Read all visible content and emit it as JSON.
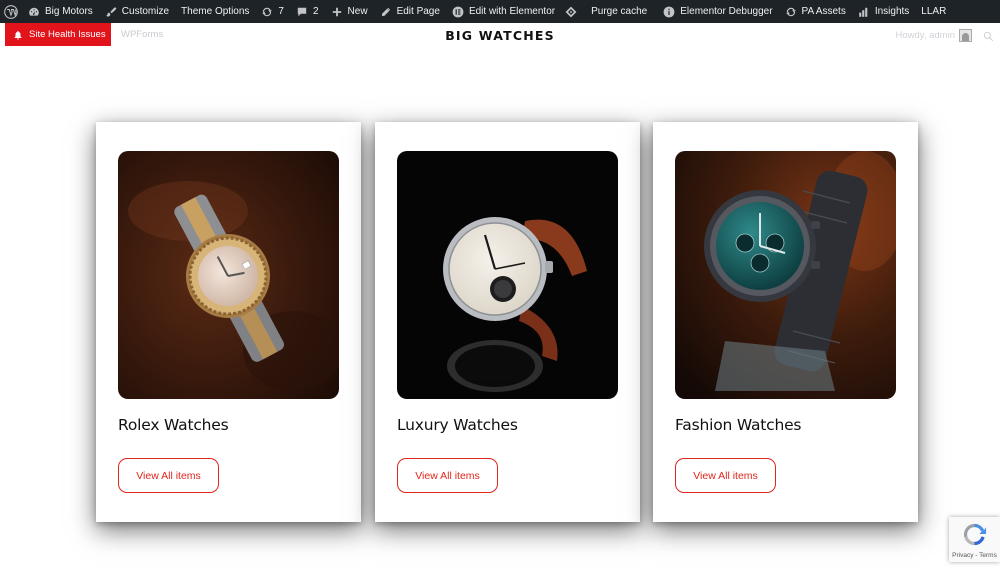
{
  "adminbar": {
    "items": [
      {
        "key": "wp",
        "label": "",
        "icon": "wordpress-logo-icon"
      },
      {
        "key": "site",
        "label": "Big Motors",
        "icon": "dashboard-icon"
      },
      {
        "key": "customize",
        "label": "Customize",
        "icon": "paintbrush-icon"
      },
      {
        "key": "theme",
        "label": "Theme Options",
        "icon": ""
      },
      {
        "key": "updates",
        "label": "7",
        "icon": "refresh-icon"
      },
      {
        "key": "comments",
        "label": "2",
        "icon": "comment-icon"
      },
      {
        "key": "new",
        "label": "New",
        "icon": "plus-icon"
      },
      {
        "key": "edit",
        "label": "Edit Page",
        "icon": "pencil-icon"
      },
      {
        "key": "elementor",
        "label": "Edit with Elementor",
        "icon": "elementor-icon"
      },
      {
        "key": "purge",
        "label": "Purge cache",
        "icon": "diamond-icon"
      },
      {
        "key": "debugger",
        "label": "Elementor Debugger",
        "icon": "info-icon"
      },
      {
        "key": "pa",
        "label": "PA Assets",
        "icon": "refresh-icon"
      },
      {
        "key": "insights",
        "label": "Insights",
        "icon": "bar-chart-icon"
      },
      {
        "key": "llar",
        "label": "LLAR",
        "icon": ""
      }
    ]
  },
  "header": {
    "health_label": "Site Health Issues",
    "wpforms_label": "WPForms",
    "site_title": "BIG WATCHES",
    "howdy_label": "Howdy, admin"
  },
  "cards": [
    {
      "title": "Rolex Watches",
      "button": "View All items"
    },
    {
      "title": "Luxury Watches",
      "button": "View All items"
    },
    {
      "title": "Fashion Watches",
      "button": "View All items"
    }
  ],
  "recaptcha": {
    "text": "Privacy - Terms"
  },
  "colors": {
    "adminbar": "#1d2327",
    "accent": "#e0261b",
    "health": "#e1141c"
  }
}
